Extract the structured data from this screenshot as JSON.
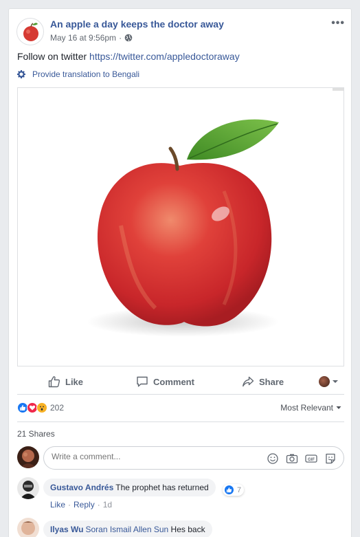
{
  "post": {
    "page_name": "An apple a day keeps the doctor away",
    "timestamp": "May 16 at 9:56pm",
    "timestamp_sep": "·",
    "text_prefix": "Follow on twitter ",
    "link": "https://twitter.com/appledoctoraway",
    "translate_label": "Provide translation to Bengali",
    "more_label": "•••",
    "privacy_icon": "globe-icon",
    "photo_subject": "apple"
  },
  "actions": {
    "like": "Like",
    "comment": "Comment",
    "share": "Share"
  },
  "stats": {
    "reaction_icons": [
      "like",
      "love",
      "wow"
    ],
    "reaction_count": "202",
    "sort_label": "Most Relevant",
    "shares": "21 Shares"
  },
  "composer": {
    "placeholder": "Write a comment..."
  },
  "comments": [
    {
      "author": "Gustavo Andrés",
      "text": "The prophet has returned",
      "likes": "7",
      "like_label": "Like",
      "reply_label": "Reply",
      "sep": "·",
      "time": "1d"
    },
    {
      "author": "Ilyas Wu",
      "tagged": "Soran Ismail Allen Sun",
      "text": "Hes back"
    }
  ],
  "colors": {
    "link": "#385898",
    "like_blue": "#1877f2",
    "love_red": "#f0284a",
    "wow_yellow": "#f7b125"
  }
}
